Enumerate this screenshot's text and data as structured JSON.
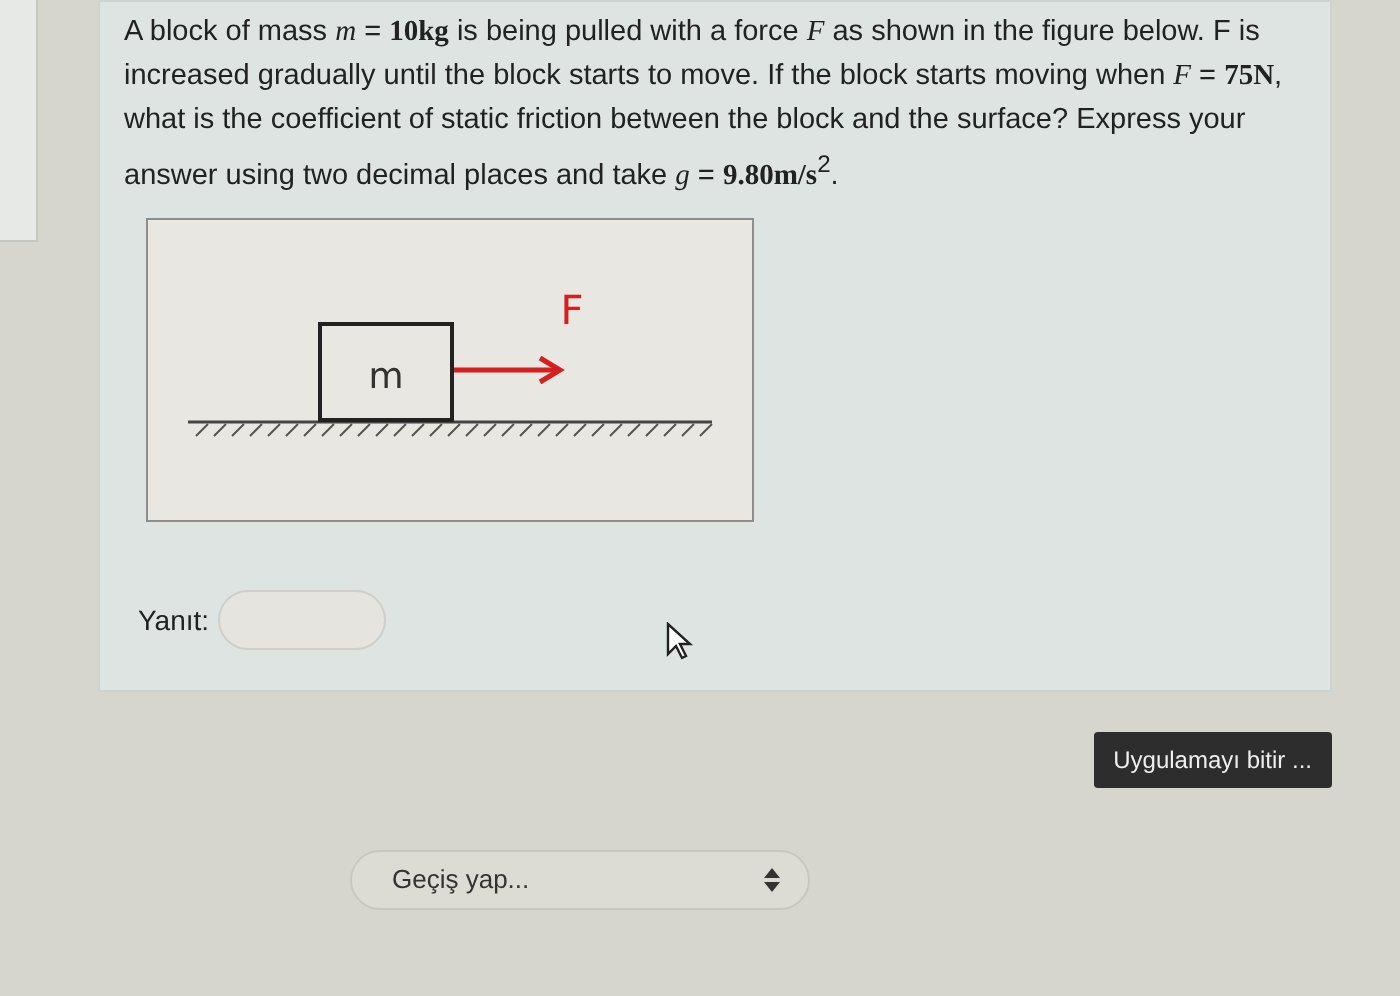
{
  "question": {
    "text": "A block of mass *m* = **10kg** is being pulled with a force *F* as shown in the figure below. F is increased gradually until the block starts to move. If the block starts moving when *F* = **75N**, what is the coefficient of static friction between the block and the surface? Express your answer using two decimal places and take *g* = **9.80m/s**$^{2}$.",
    "figure": {
      "block_label": "m",
      "force_label": "F"
    },
    "answer": {
      "label": "Yanıt:"
    }
  },
  "finish_button": "Uygulamayı bitir ...",
  "jump_select": {
    "placeholder": "Geçiş yap..."
  }
}
